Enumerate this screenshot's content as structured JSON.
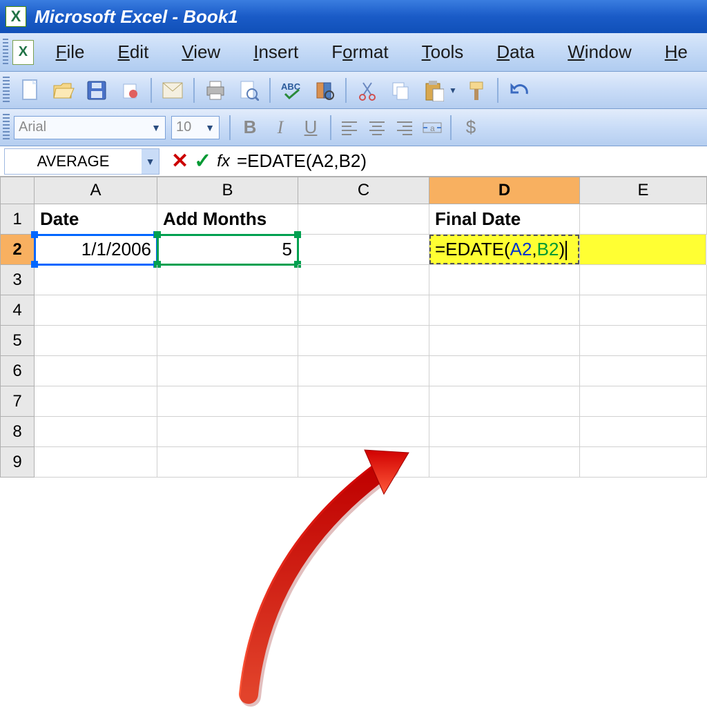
{
  "title": "Microsoft Excel - Book1",
  "menu": {
    "file": "File",
    "edit": "Edit",
    "view": "View",
    "insert": "Insert",
    "format": "Format",
    "tools": "Tools",
    "data": "Data",
    "window": "Window",
    "help": "He"
  },
  "format_bar": {
    "font": "Arial",
    "size": "10",
    "bold": "B",
    "italic": "I",
    "underline": "U",
    "currency": "$"
  },
  "formula_bar": {
    "name_box": "AVERAGE",
    "cancel": "✕",
    "enter": "✓",
    "fx": "fx",
    "formula": "=EDATE(A2,B2)"
  },
  "columns": [
    "A",
    "B",
    "C",
    "D",
    "E"
  ],
  "rows": [
    "1",
    "2",
    "3",
    "4",
    "5",
    "6",
    "7",
    "8",
    "9"
  ],
  "selected_column": "D",
  "selected_row": "2",
  "cells": {
    "A1": "Date",
    "B1": "Add Months",
    "D1": "Final Date",
    "A2": "1/1/2006",
    "B2": "5",
    "D2_prefix": "=EDATE(",
    "D2_refA": "A2",
    "D2_comma": ",",
    "D2_refB": "B2",
    "D2_suffix": ")"
  }
}
